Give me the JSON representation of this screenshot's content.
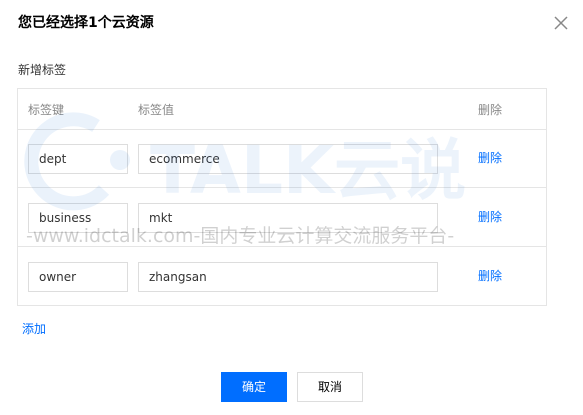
{
  "dialog": {
    "title": "您已经选择1个云资源",
    "section_label": "新增标签"
  },
  "table": {
    "headers": {
      "key": "标签键",
      "value": "标签值",
      "operation": "删除"
    },
    "rows": [
      {
        "key": "dept",
        "value": "ecommerce",
        "delete_label": "删除"
      },
      {
        "key": "business",
        "value": "mkt",
        "delete_label": "删除"
      },
      {
        "key": "owner",
        "value": "zhangsan",
        "delete_label": "删除"
      }
    ]
  },
  "add_label": "添加",
  "buttons": {
    "confirm": "确定",
    "cancel": "取消"
  },
  "watermark": {
    "brand": "TALK云说",
    "url": "-www.idctalk.com-国内专业云计算交流服务平台-"
  },
  "colors": {
    "primary": "#006eff",
    "border": "#e5e5e5",
    "muted": "#888888"
  },
  "icons": {
    "close": "close-icon"
  }
}
